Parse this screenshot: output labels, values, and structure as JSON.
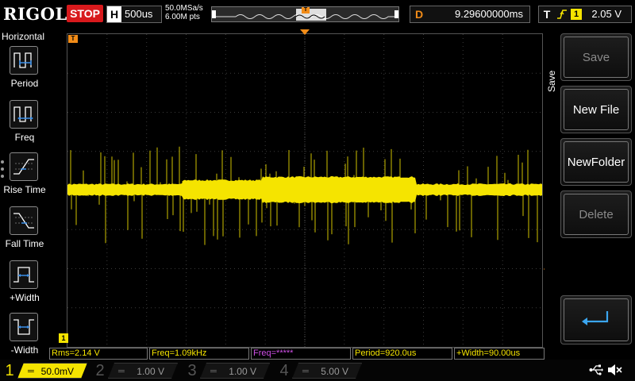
{
  "topbar": {
    "logo": "RIGOL",
    "run_status": "STOP",
    "timebase_label": "H",
    "timebase_value": "500us",
    "sample_rate": "50.0MSa/s",
    "memory_depth": "6.00M pts",
    "trigger_pos_glyph": "T",
    "delay_label": "D",
    "delay_value": "9.29600000ms",
    "trigger_label": "T",
    "trigger_source": "1",
    "trigger_level": "2.05 V"
  },
  "left_menu": {
    "title": "Horizontal",
    "items": [
      {
        "label": "Period",
        "icon": "period-icon"
      },
      {
        "label": "Freq",
        "icon": "frequency-icon"
      },
      {
        "label": "Rise Time",
        "icon": "rise-time-icon"
      },
      {
        "label": "Fall Time",
        "icon": "fall-time-icon"
      },
      {
        "label": "+Width",
        "icon": "positive-width-icon"
      },
      {
        "label": "-Width",
        "icon": "negative-width-icon"
      }
    ]
  },
  "right_menu": {
    "title": "Save",
    "softkeys": [
      {
        "label": "Save",
        "enabled": false
      },
      {
        "label": "New File",
        "enabled": true
      },
      {
        "label": "NewFolder",
        "enabled": true
      },
      {
        "label": "Delete",
        "enabled": false
      }
    ],
    "return_icon": "return-icon"
  },
  "markers": {
    "trigger_time": "T",
    "ch1": "1"
  },
  "measurements": [
    {
      "text": "Rms=2.14 V",
      "color": "#f5e400"
    },
    {
      "text": "Freq=1.09kHz",
      "color": "#f5e400"
    },
    {
      "text": "Freq=*****",
      "color": "#d050e8"
    },
    {
      "text": "Period=920.0us",
      "color": "#f5e400"
    },
    {
      "text": "+Width=90.00us",
      "color": "#f5e400"
    }
  ],
  "channels": [
    {
      "num": "1",
      "scale": "50.0mV",
      "active": true,
      "color": "#f5e400"
    },
    {
      "num": "2",
      "scale": "1.00 V",
      "active": false,
      "color": "#2dd4c8"
    },
    {
      "num": "3",
      "scale": "1.00 V",
      "active": false,
      "color": "#d050e8"
    },
    {
      "num": "4",
      "scale": "5.00 V",
      "active": false,
      "color": "#3b8fe8"
    }
  ],
  "colors": {
    "ch1": "#f5e400",
    "stop": "#d8191c",
    "trigger": "#f28c18",
    "grid": "#3a3a3a"
  },
  "status_icons": [
    "usb-icon",
    "speaker-muted-icon"
  ]
}
